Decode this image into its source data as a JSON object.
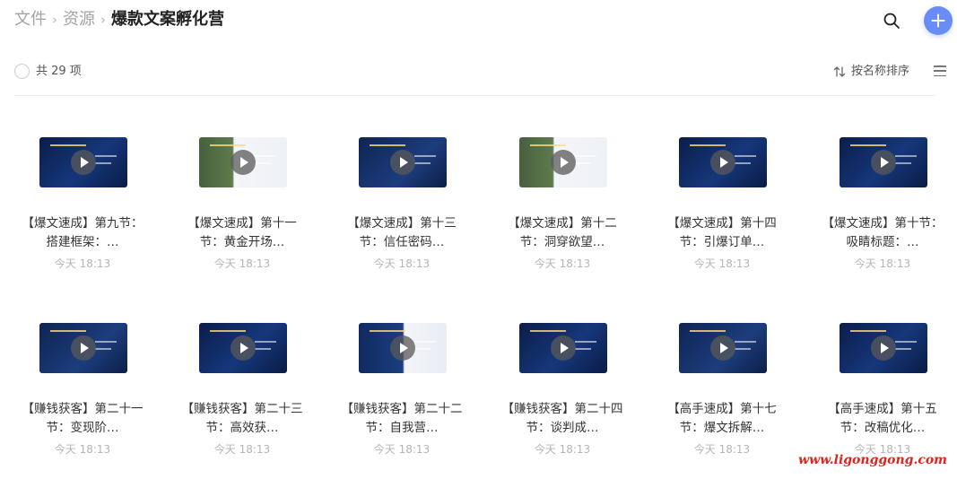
{
  "breadcrumb": {
    "items": [
      "文件",
      "资源"
    ],
    "current": "爆款文案孵化营",
    "separator": "›"
  },
  "header": {
    "search_icon": "search-icon",
    "add_icon": "plus-icon",
    "accent_color": "#6a8cf6"
  },
  "toolbar": {
    "count_label": "共 29 项",
    "sort_label": "按名称排序",
    "sort_icon": "sort-arrows-icon",
    "view_icon": "list-view-icon"
  },
  "files": [
    {
      "title": "【爆文速成】第九节：搭建框架：…",
      "time": "今天 18:13",
      "thumb": "dark"
    },
    {
      "title": "【爆文速成】第十一节：黄金开场…",
      "time": "今天 18:13",
      "thumb": "light"
    },
    {
      "title": "【爆文速成】第十三节：信任密码…",
      "time": "今天 18:13",
      "thumb": "photo"
    },
    {
      "title": "【爆文速成】第十二节：洞穿欲望…",
      "time": "今天 18:13",
      "thumb": "light"
    },
    {
      "title": "【爆文速成】第十四节：引爆订单…",
      "time": "今天 18:13",
      "thumb": "dark"
    },
    {
      "title": "【爆文速成】第十节：吸睛标题：…",
      "time": "今天 18:13",
      "thumb": "dark"
    },
    {
      "title": "【赚钱获客】第二十一节：变现阶…",
      "time": "今天 18:13",
      "thumb": "photo"
    },
    {
      "title": "【赚钱获客】第二十三节：高效获…",
      "time": "今天 18:13",
      "thumb": "dark"
    },
    {
      "title": "【赚钱获客】第二十二节：自我营…",
      "time": "今天 18:13",
      "thumb": "split"
    },
    {
      "title": "【赚钱获客】第二十四节：谈判成…",
      "time": "今天 18:13",
      "thumb": "dark"
    },
    {
      "title": "【高手速成】第十七节：爆文拆解…",
      "time": "今天 18:13",
      "thumb": "photo"
    },
    {
      "title": "【高手速成】第十五节：改稿优化…",
      "time": "今天 18:13",
      "thumb": "dark"
    }
  ],
  "watermark": "www.ligonggong.com"
}
